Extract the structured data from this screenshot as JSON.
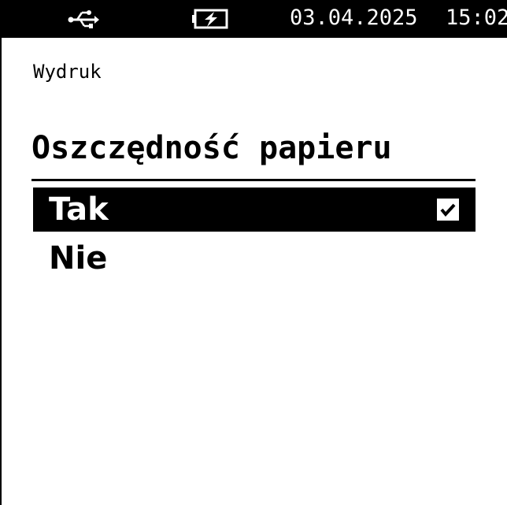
{
  "status_bar": {
    "usb_icon": "usb-icon",
    "battery_icon": "battery-charging-icon",
    "date": "03.04.2025",
    "time": "15:02"
  },
  "breadcrumb": "Wydruk",
  "title": "Oszczędność papieru",
  "options": [
    {
      "label": "Tak",
      "selected": true,
      "checked": true
    },
    {
      "label": "Nie",
      "selected": false,
      "checked": false
    }
  ],
  "colors": {
    "background": "#ffffff",
    "foreground": "#000000",
    "highlight": "#000000"
  }
}
